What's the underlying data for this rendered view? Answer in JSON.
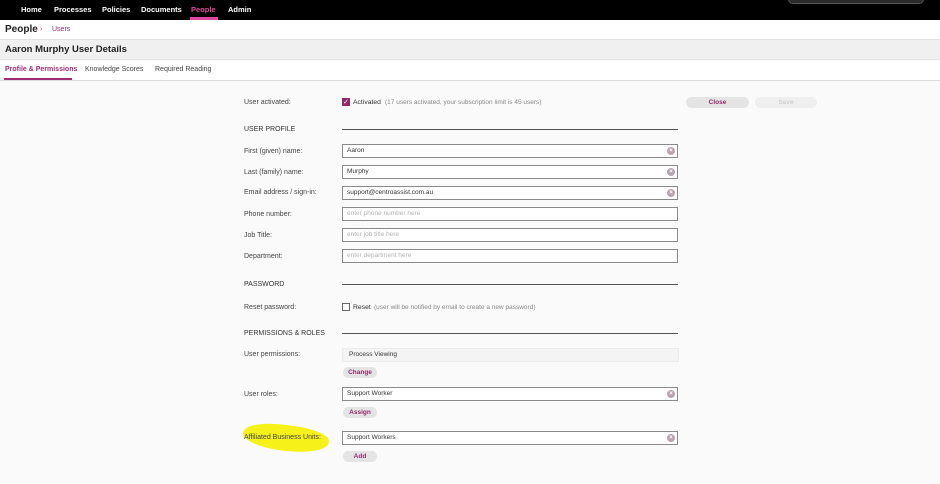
{
  "nav": {
    "items": [
      "Home",
      "Processes",
      "Policies",
      "Documents",
      "People",
      "Admin"
    ],
    "active": "People"
  },
  "breadcrumb": {
    "title": "People",
    "separator": "›",
    "link": "Users"
  },
  "page": {
    "title": "Aaron Murphy User Details"
  },
  "tabs": [
    "Profile & Permissions",
    "Knowledge Scores",
    "Required Reading"
  ],
  "actions": {
    "close": "Close",
    "save": "Save"
  },
  "activation": {
    "label": "User activated:",
    "checkbox_label": "Activated",
    "checked": true,
    "note": "(17 users activated, your subscription limit is 45 users)"
  },
  "profile": {
    "heading": "USER PROFILE",
    "first_name": {
      "label": "First (given) name:",
      "value": "Aaron"
    },
    "last_name": {
      "label": "Last (family) name:",
      "value": "Murphy"
    },
    "email": {
      "label": "Email address / sign-in:",
      "value": "support@centroassist.com.au"
    },
    "phone": {
      "label": "Phone number:",
      "placeholder": "enter phone number here"
    },
    "job_title": {
      "label": "Job Title:",
      "placeholder": "enter job title here"
    },
    "department": {
      "label": "Department:",
      "placeholder": "enter department here"
    }
  },
  "password": {
    "heading": "PASSWORD",
    "label": "Reset password:",
    "checkbox_label": "Reset",
    "note": "(user will be notified by email to create a new password)"
  },
  "permissions": {
    "heading": "PERMISSIONS & ROLES",
    "user_permissions": {
      "label": "User permissions:",
      "value": "Process Viewing",
      "button": "Change"
    },
    "user_roles": {
      "label": "User roles:",
      "value": "Support Worker",
      "button": "Assign"
    },
    "business_units": {
      "label": "Affiliated Business Units:",
      "value": "Support Workers",
      "button": "Add"
    }
  },
  "colors": {
    "accent": "#a02d74",
    "nav_active": "#e0479e",
    "highlight": "#f4f000"
  }
}
